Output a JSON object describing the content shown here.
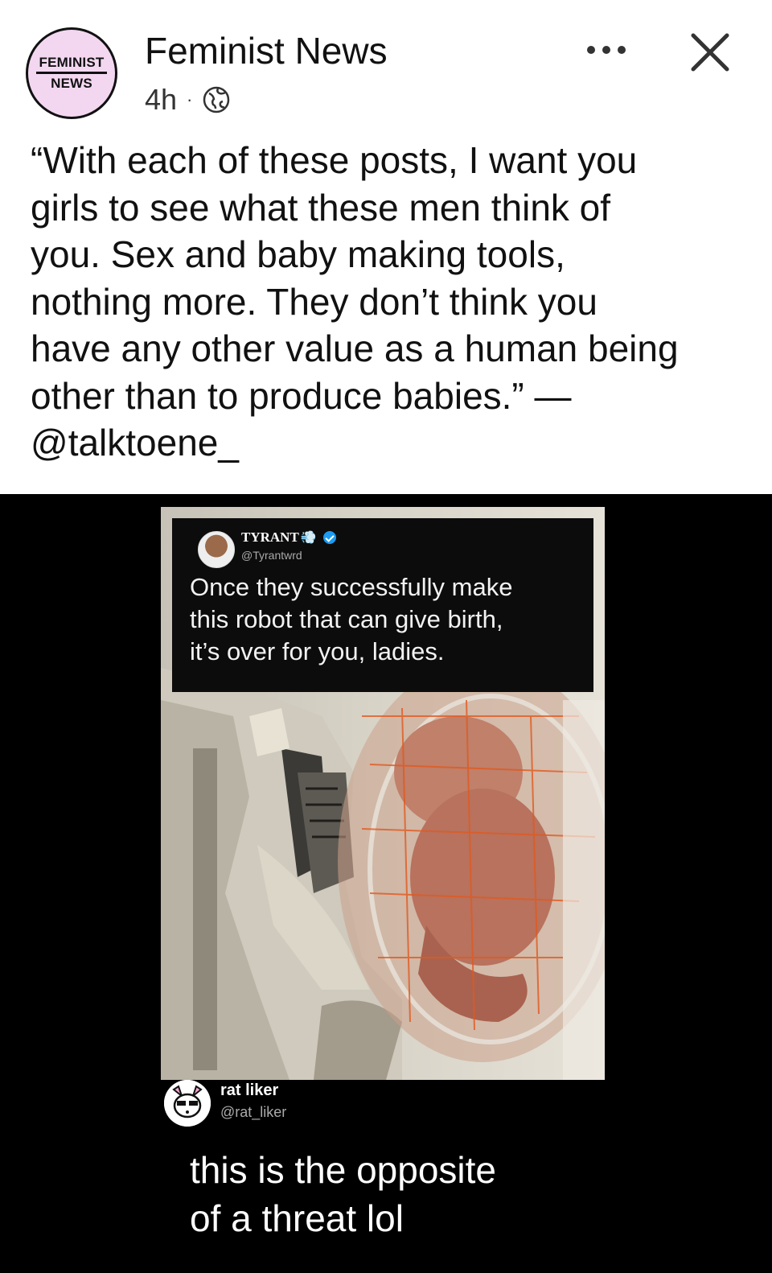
{
  "post": {
    "page_logo_line1": "FEMINIST",
    "page_logo_line2": "NEWS",
    "page_name": "Feminist News",
    "timestamp": "4h",
    "separator": "·",
    "audience_icon": "globe-icon",
    "more_icon": "more-horizontal-icon",
    "close_icon": "close-icon",
    "caption": "“With each of these posts, I want you\ngirls to see what these men think of\nyou. Sex and baby making tools,\nnothing more. They don’t think you\nhave any other value as a human being\nother than to produce babies.” —\n@talktoene_"
  },
  "media": {
    "quoted_tweet": {
      "name": "TYRANT",
      "name_emoji": "💨",
      "verified": true,
      "handle": "@Tyrantwrd",
      "text": "Once they successfully make\nthis robot that can give birth,\nit’s over for you, ladies."
    },
    "reply": {
      "name": "rat liker",
      "handle": "@rat_liker",
      "text": "this is the opposite\nof a threat lol"
    }
  },
  "colors": {
    "background": "#ffffff",
    "logo_pink": "#f3d7f1",
    "media_background": "#000000",
    "verified_blue": "#1d9bf0"
  }
}
